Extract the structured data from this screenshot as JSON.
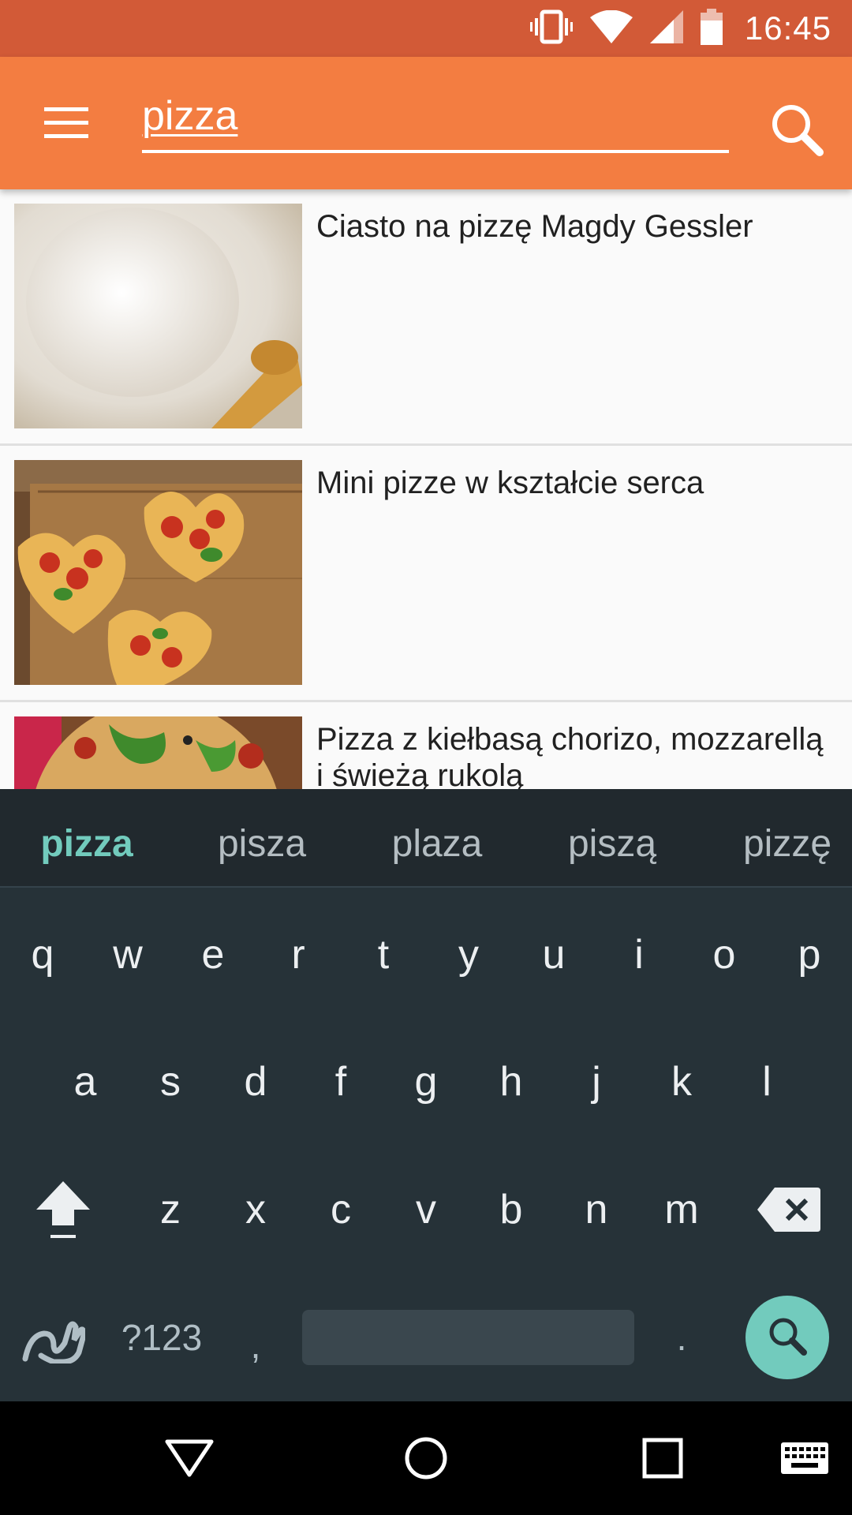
{
  "status_bar": {
    "time": "16:45",
    "icons": [
      "vibrate-icon",
      "wifi-icon",
      "cell-signal-icon",
      "battery-icon"
    ]
  },
  "app_bar": {
    "menu_icon": "hamburger-menu-icon",
    "search_value": "pizza",
    "search_icon": "search-icon",
    "background": "#f37d41",
    "status_background": "#d25a37"
  },
  "results": [
    {
      "title": "Ciasto na pizzę Magdy Gessler",
      "image": "dough-photo"
    },
    {
      "title": "Mini pizze w kształcie serca",
      "image": "heart-pizzas-photo"
    },
    {
      "title": "Pizza z kiełbasą chorizo, mozzarellą i świeżą rukolą",
      "image": "chorizo-pizza-photo"
    }
  ],
  "keyboard": {
    "suggestions": [
      "pizza",
      "pisza",
      "plaza",
      "piszą",
      "pizzę"
    ],
    "row1": [
      "q",
      "w",
      "e",
      "r",
      "t",
      "y",
      "u",
      "i",
      "o",
      "p"
    ],
    "row2": [
      "a",
      "s",
      "d",
      "f",
      "g",
      "h",
      "j",
      "k",
      "l"
    ],
    "row3": [
      "z",
      "x",
      "c",
      "v",
      "b",
      "n",
      "m"
    ],
    "symbols_label": "?123",
    "comma": ",",
    "period": ".",
    "accent": "#72cbbd",
    "background": "#263238"
  },
  "nav_bar": {
    "buttons": [
      "back-icon",
      "home-icon",
      "recents-icon",
      "keyboard-switch-icon"
    ]
  }
}
